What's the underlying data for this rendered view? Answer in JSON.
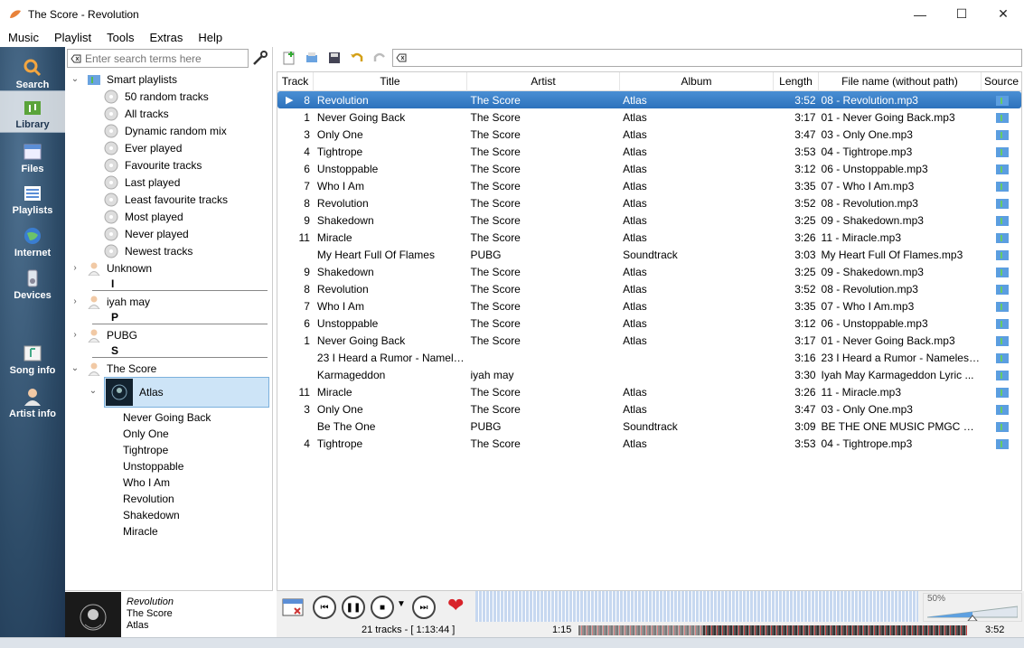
{
  "window": {
    "title": "The Score - Revolution"
  },
  "menu": [
    "Music",
    "Playlist",
    "Tools",
    "Extras",
    "Help"
  ],
  "fancy_tabs": [
    {
      "label": "Search",
      "icon": "search-icon"
    },
    {
      "label": "Library",
      "icon": "library-icon",
      "active": true
    },
    {
      "label": "Files",
      "icon": "files-icon"
    },
    {
      "label": "Playlists",
      "icon": "playlists-icon"
    },
    {
      "label": "Internet",
      "icon": "internet-icon"
    },
    {
      "label": "Devices",
      "icon": "devices-icon"
    },
    {
      "label": "Song info",
      "icon": "song-info-icon"
    },
    {
      "label": "Artist info",
      "icon": "artist-info-icon"
    }
  ],
  "library": {
    "search_placeholder": "Enter search terms here",
    "smart_playlists_label": "Smart playlists",
    "smart_playlists": [
      "50 random tracks",
      "All tracks",
      "Dynamic random mix",
      "Ever played",
      "Favourite tracks",
      "Last played",
      "Least favourite tracks",
      "Most played",
      "Never played",
      "Newest tracks"
    ],
    "artists": [
      {
        "name": "Unknown",
        "divider": "I"
      },
      {
        "name": "iyah may",
        "divider": "P"
      },
      {
        "name": "PUBG",
        "divider": "S"
      },
      {
        "name": "The Score"
      }
    ],
    "album": "Atlas",
    "album_tracks": [
      "Never Going Back",
      "Only One",
      "Tightrope",
      "Unstoppable",
      "Who I Am",
      "Revolution",
      "Shakedown",
      "Miracle"
    ]
  },
  "now_playing": {
    "title": "Revolution",
    "artist": "The Score",
    "album": "Atlas"
  },
  "playlist": {
    "columns": [
      "Track",
      "Title",
      "Artist",
      "Album",
      "Length",
      "File name (without path)",
      "Source"
    ],
    "rows": [
      {
        "track": "8",
        "title": "Revolution",
        "artist": "The Score",
        "album": "Atlas",
        "length": "3:52",
        "file": "08 - Revolution.mp3",
        "playing": true
      },
      {
        "track": "1",
        "title": "Never Going Back",
        "artist": "The Score",
        "album": "Atlas",
        "length": "3:17",
        "file": "01 - Never Going Back.mp3"
      },
      {
        "track": "3",
        "title": "Only One",
        "artist": "The Score",
        "album": "Atlas",
        "length": "3:47",
        "file": "03 - Only One.mp3"
      },
      {
        "track": "4",
        "title": "Tightrope",
        "artist": "The Score",
        "album": "Atlas",
        "length": "3:53",
        "file": "04 - Tightrope.mp3"
      },
      {
        "track": "6",
        "title": "Unstoppable",
        "artist": "The Score",
        "album": "Atlas",
        "length": "3:12",
        "file": "06 - Unstoppable.mp3"
      },
      {
        "track": "7",
        "title": "Who I Am",
        "artist": "The Score",
        "album": "Atlas",
        "length": "3:35",
        "file": "07 - Who I Am.mp3"
      },
      {
        "track": "8",
        "title": "Revolution",
        "artist": "The Score",
        "album": "Atlas",
        "length": "3:52",
        "file": "08 - Revolution.mp3"
      },
      {
        "track": "9",
        "title": "Shakedown",
        "artist": "The Score",
        "album": "Atlas",
        "length": "3:25",
        "file": "09 - Shakedown.mp3"
      },
      {
        "track": "11",
        "title": "Miracle",
        "artist": "The Score",
        "album": "Atlas",
        "length": "3:26",
        "file": "11 - Miracle.mp3"
      },
      {
        "track": "",
        "title": "My Heart Full Of Flames",
        "artist": "PUBG",
        "album": "Soundtrack",
        "length": "3:03",
        "file": "My Heart Full Of Flames.mp3"
      },
      {
        "track": "9",
        "title": "Shakedown",
        "artist": "The Score",
        "album": "Atlas",
        "length": "3:25",
        "file": "09 - Shakedown.mp3"
      },
      {
        "track": "8",
        "title": "Revolution",
        "artist": "The Score",
        "album": "Atlas",
        "length": "3:52",
        "file": "08 - Revolution.mp3"
      },
      {
        "track": "7",
        "title": "Who I Am",
        "artist": "The Score",
        "album": "Atlas",
        "length": "3:35",
        "file": "07 - Who I Am.mp3"
      },
      {
        "track": "6",
        "title": "Unstoppable",
        "artist": "The Score",
        "album": "Atlas",
        "length": "3:12",
        "file": "06 - Unstoppable.mp3"
      },
      {
        "track": "1",
        "title": "Never Going Back",
        "artist": "The Score",
        "album": "Atlas",
        "length": "3:17",
        "file": "01 - Never Going Back.mp3"
      },
      {
        "track": "",
        "title": "23 I Heard a Rumor - Namele...",
        "artist": "",
        "album": "",
        "length": "3:16",
        "file": "23 I Heard a Rumor - Nameless..."
      },
      {
        "track": "",
        "title": "Karmageddon",
        "artist": "iyah may",
        "album": "",
        "length": "3:30",
        "file": "Iyah May Karmageddon Lyric ..."
      },
      {
        "track": "11",
        "title": "Miracle",
        "artist": "The Score",
        "album": "Atlas",
        "length": "3:26",
        "file": "11 - Miracle.mp3"
      },
      {
        "track": "3",
        "title": "Only One",
        "artist": "The Score",
        "album": "Atlas",
        "length": "3:47",
        "file": "03 - Only One.mp3"
      },
      {
        "track": "",
        "title": "Be The One",
        "artist": "PUBG",
        "album": "Soundtrack",
        "length": "3:09",
        "file": "BE THE ONE MUSIC PMGC 202..."
      },
      {
        "track": "4",
        "title": "Tightrope",
        "artist": "The Score",
        "album": "Atlas",
        "length": "3:53",
        "file": "04 - Tightrope.mp3"
      }
    ]
  },
  "player": {
    "volume_label": "50%",
    "volume": 0.5
  },
  "status": {
    "tracks": "21 tracks - [ 1:13:44 ]",
    "elapsed": "1:15",
    "total": "3:52",
    "progress": 0.32
  },
  "colors": {
    "accent": "#2d72bc",
    "tab_bg": "#2c4a66",
    "selection": "#cde4f7"
  }
}
